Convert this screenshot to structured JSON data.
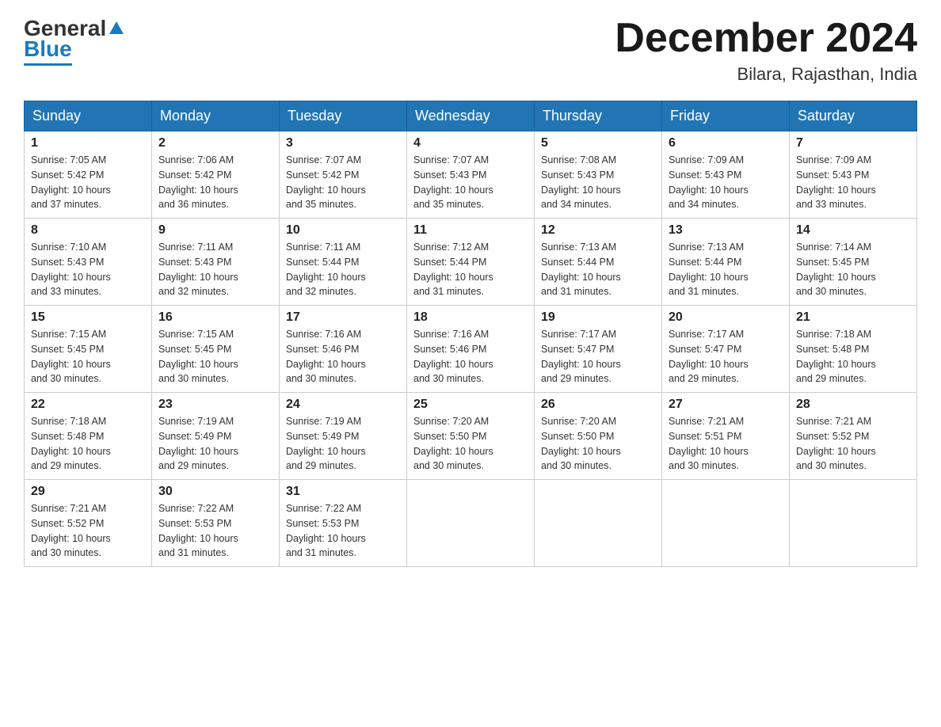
{
  "header": {
    "logo": {
      "general": "General",
      "blue": "Blue"
    },
    "month_title": "December 2024",
    "location": "Bilara, Rajasthan, India"
  },
  "weekdays": [
    "Sunday",
    "Monday",
    "Tuesday",
    "Wednesday",
    "Thursday",
    "Friday",
    "Saturday"
  ],
  "weeks": [
    [
      {
        "day": "1",
        "sunrise": "7:05 AM",
        "sunset": "5:42 PM",
        "daylight": "10 hours and 37 minutes."
      },
      {
        "day": "2",
        "sunrise": "7:06 AM",
        "sunset": "5:42 PM",
        "daylight": "10 hours and 36 minutes."
      },
      {
        "day": "3",
        "sunrise": "7:07 AM",
        "sunset": "5:42 PM",
        "daylight": "10 hours and 35 minutes."
      },
      {
        "day": "4",
        "sunrise": "7:07 AM",
        "sunset": "5:43 PM",
        "daylight": "10 hours and 35 minutes."
      },
      {
        "day": "5",
        "sunrise": "7:08 AM",
        "sunset": "5:43 PM",
        "daylight": "10 hours and 34 minutes."
      },
      {
        "day": "6",
        "sunrise": "7:09 AM",
        "sunset": "5:43 PM",
        "daylight": "10 hours and 34 minutes."
      },
      {
        "day": "7",
        "sunrise": "7:09 AM",
        "sunset": "5:43 PM",
        "daylight": "10 hours and 33 minutes."
      }
    ],
    [
      {
        "day": "8",
        "sunrise": "7:10 AM",
        "sunset": "5:43 PM",
        "daylight": "10 hours and 33 minutes."
      },
      {
        "day": "9",
        "sunrise": "7:11 AM",
        "sunset": "5:43 PM",
        "daylight": "10 hours and 32 minutes."
      },
      {
        "day": "10",
        "sunrise": "7:11 AM",
        "sunset": "5:44 PM",
        "daylight": "10 hours and 32 minutes."
      },
      {
        "day": "11",
        "sunrise": "7:12 AM",
        "sunset": "5:44 PM",
        "daylight": "10 hours and 31 minutes."
      },
      {
        "day": "12",
        "sunrise": "7:13 AM",
        "sunset": "5:44 PM",
        "daylight": "10 hours and 31 minutes."
      },
      {
        "day": "13",
        "sunrise": "7:13 AM",
        "sunset": "5:44 PM",
        "daylight": "10 hours and 31 minutes."
      },
      {
        "day": "14",
        "sunrise": "7:14 AM",
        "sunset": "5:45 PM",
        "daylight": "10 hours and 30 minutes."
      }
    ],
    [
      {
        "day": "15",
        "sunrise": "7:15 AM",
        "sunset": "5:45 PM",
        "daylight": "10 hours and 30 minutes."
      },
      {
        "day": "16",
        "sunrise": "7:15 AM",
        "sunset": "5:45 PM",
        "daylight": "10 hours and 30 minutes."
      },
      {
        "day": "17",
        "sunrise": "7:16 AM",
        "sunset": "5:46 PM",
        "daylight": "10 hours and 30 minutes."
      },
      {
        "day": "18",
        "sunrise": "7:16 AM",
        "sunset": "5:46 PM",
        "daylight": "10 hours and 30 minutes."
      },
      {
        "day": "19",
        "sunrise": "7:17 AM",
        "sunset": "5:47 PM",
        "daylight": "10 hours and 29 minutes."
      },
      {
        "day": "20",
        "sunrise": "7:17 AM",
        "sunset": "5:47 PM",
        "daylight": "10 hours and 29 minutes."
      },
      {
        "day": "21",
        "sunrise": "7:18 AM",
        "sunset": "5:48 PM",
        "daylight": "10 hours and 29 minutes."
      }
    ],
    [
      {
        "day": "22",
        "sunrise": "7:18 AM",
        "sunset": "5:48 PM",
        "daylight": "10 hours and 29 minutes."
      },
      {
        "day": "23",
        "sunrise": "7:19 AM",
        "sunset": "5:49 PM",
        "daylight": "10 hours and 29 minutes."
      },
      {
        "day": "24",
        "sunrise": "7:19 AM",
        "sunset": "5:49 PM",
        "daylight": "10 hours and 29 minutes."
      },
      {
        "day": "25",
        "sunrise": "7:20 AM",
        "sunset": "5:50 PM",
        "daylight": "10 hours and 30 minutes."
      },
      {
        "day": "26",
        "sunrise": "7:20 AM",
        "sunset": "5:50 PM",
        "daylight": "10 hours and 30 minutes."
      },
      {
        "day": "27",
        "sunrise": "7:21 AM",
        "sunset": "5:51 PM",
        "daylight": "10 hours and 30 minutes."
      },
      {
        "day": "28",
        "sunrise": "7:21 AM",
        "sunset": "5:52 PM",
        "daylight": "10 hours and 30 minutes."
      }
    ],
    [
      {
        "day": "29",
        "sunrise": "7:21 AM",
        "sunset": "5:52 PM",
        "daylight": "10 hours and 30 minutes."
      },
      {
        "day": "30",
        "sunrise": "7:22 AM",
        "sunset": "5:53 PM",
        "daylight": "10 hours and 31 minutes."
      },
      {
        "day": "31",
        "sunrise": "7:22 AM",
        "sunset": "5:53 PM",
        "daylight": "10 hours and 31 minutes."
      },
      null,
      null,
      null,
      null
    ]
  ],
  "labels": {
    "sunrise": "Sunrise:",
    "sunset": "Sunset:",
    "daylight": "Daylight:"
  }
}
